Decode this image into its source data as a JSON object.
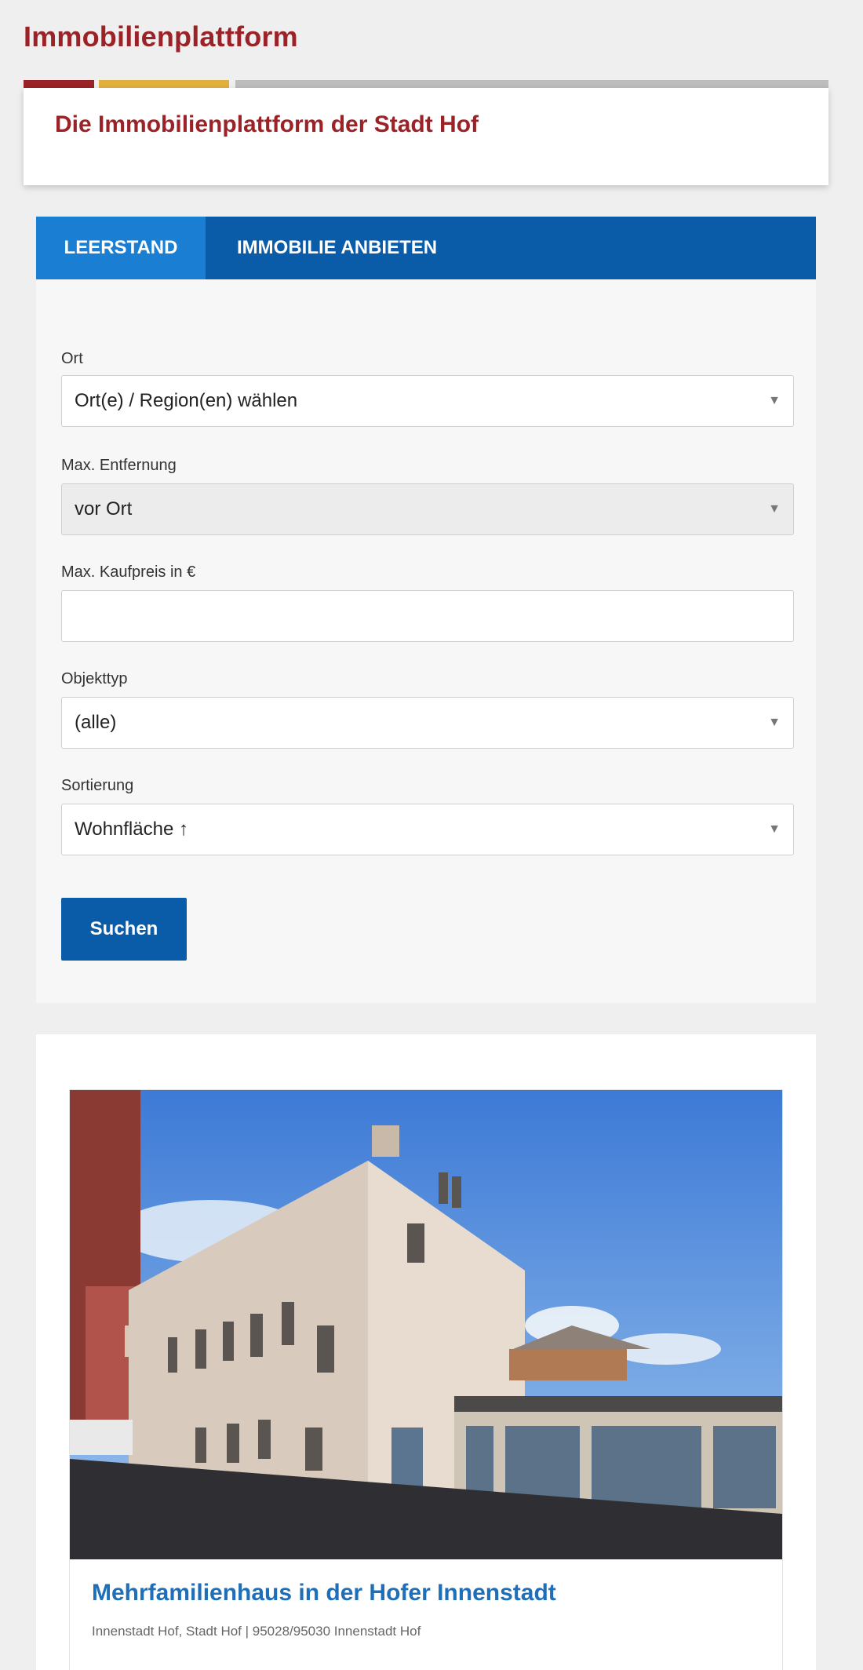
{
  "header": {
    "site_title": "Immobilienplattform",
    "intro_title": "Die Immobilienplattform der Stadt Hof"
  },
  "colors": {
    "brand_red": "#9b2226",
    "brand_yellow": "#e2b03d",
    "brand_blue": "#0b5ca8",
    "tab_active_blue": "#1a7fd3"
  },
  "tabs": [
    {
      "label": "LEERSTAND",
      "active": true
    },
    {
      "label": "IMMOBILIE ANBIETEN",
      "active": false
    }
  ],
  "search": {
    "ort_label": "Ort",
    "ort_value": "Ort(e) / Region(en) wählen",
    "distance_label": "Max. Entfernung",
    "distance_value": "vor Ort",
    "price_label": "Max. Kaufpreis in €",
    "price_value": "",
    "type_label": "Objekttyp",
    "type_value": "(alle)",
    "sort_label": "Sortierung",
    "sort_value": "Wohnfläche ↑",
    "submit_label": "Suchen"
  },
  "results": [
    {
      "title": "Mehrfamilienhaus in der Hofer Innenstadt",
      "location": "Innenstadt Hof, Stadt Hof | 95028/95030 Innenstadt Hof"
    }
  ],
  "icons": {
    "dropdown": "chevron-down-icon"
  }
}
